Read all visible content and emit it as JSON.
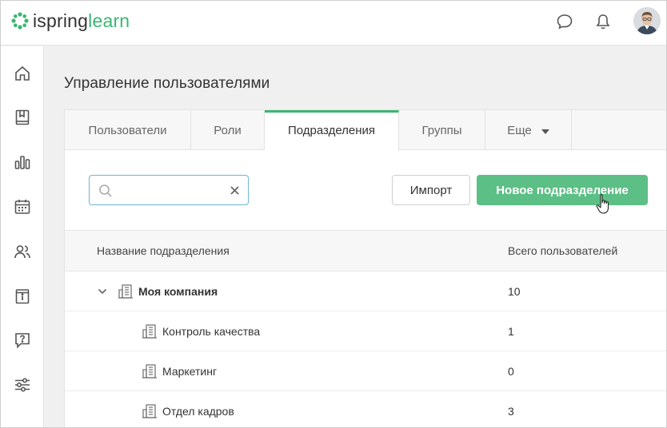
{
  "header": {
    "logo": {
      "part1": "ispring",
      "part2": "learn"
    },
    "icons": [
      "chat-icon",
      "bell-icon"
    ],
    "colors": {
      "brand": "#3bb673",
      "accent_button": "#5cbf85"
    }
  },
  "sidebar": {
    "items": [
      {
        "name": "home-icon"
      },
      {
        "name": "courses-icon"
      },
      {
        "name": "reports-icon"
      },
      {
        "name": "calendar-icon"
      },
      {
        "name": "users-icon"
      },
      {
        "name": "info-icon"
      },
      {
        "name": "help-icon"
      },
      {
        "name": "settings-icon"
      }
    ]
  },
  "page": {
    "title": "Управление пользователями"
  },
  "tabs": [
    {
      "label": "Пользователи"
    },
    {
      "label": "Роли"
    },
    {
      "label": "Подразделения",
      "active": true
    },
    {
      "label": "Группы"
    },
    {
      "label": "Еще"
    }
  ],
  "toolbar": {
    "search_value": "",
    "import_label": "Импорт",
    "new_label": "Новое подразделение"
  },
  "table": {
    "columns": [
      "Название подразделения",
      "Всего пользователей"
    ],
    "rows": [
      {
        "name": "Моя компания",
        "count": "10",
        "level": 0,
        "expanded": true
      },
      {
        "name": "Контроль качества",
        "count": "1",
        "level": 1
      },
      {
        "name": "Маркетинг",
        "count": "0",
        "level": 1
      },
      {
        "name": "Отдел кадров",
        "count": "3",
        "level": 1
      }
    ]
  }
}
